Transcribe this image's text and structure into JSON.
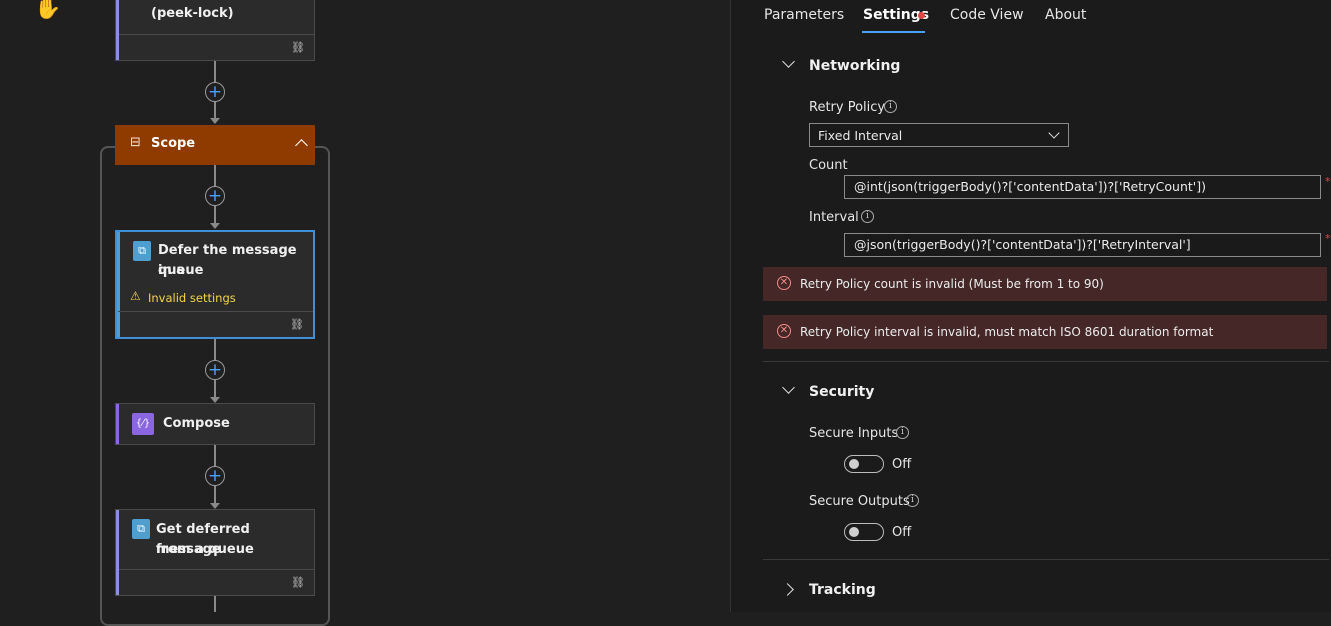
{
  "canvas": {
    "top_card": {
      "title": "(peek-lock)"
    },
    "scope": {
      "title": "Scope"
    },
    "defer_card": {
      "title_line1": "Defer the message in a",
      "title_line2": "queue",
      "warning": "Invalid settings"
    },
    "compose_card": {
      "title": "Compose"
    },
    "get_card": {
      "title_line1": "Get deferred message",
      "title_line2": "from a queue"
    },
    "icons": {
      "plus": "+",
      "link": "⛓",
      "warning": "⚠",
      "scope": "⊟",
      "collapse": "chevron-up",
      "servicebus": "service-bus-icon",
      "compose": "compose-icon"
    }
  },
  "panel": {
    "tabs": [
      "Parameters",
      "Settings",
      "Code View",
      "About"
    ],
    "active_tab": "Settings",
    "networking": {
      "heading": "Networking",
      "retry_policy_label": "Retry Policy",
      "retry_policy_value": "Fixed Interval",
      "count_label": "Count",
      "count_value": "@int(json(triggerBody()?['contentData'])?['RetryCount'])",
      "interval_label": "Interval",
      "interval_value": "@json(triggerBody()?['contentData'])?['RetryInterval']",
      "required_mark": "*"
    },
    "errors": [
      "Retry Policy count is invalid (Must be from 1 to 90)",
      "Retry Policy interval is invalid, must match ISO 8601 duration format"
    ],
    "security": {
      "heading": "Security",
      "secure_inputs_label": "Secure Inputs",
      "secure_inputs_state": "Off",
      "secure_outputs_label": "Secure Outputs",
      "secure_outputs_state": "Off"
    },
    "tracking": {
      "heading": "Tracking"
    }
  },
  "colors": {
    "accent": "#4aa0ff",
    "scope": "#8f3b00",
    "error_bg": "#442726",
    "warning": "#f5d547",
    "unsaved_dot": "#e04848"
  }
}
